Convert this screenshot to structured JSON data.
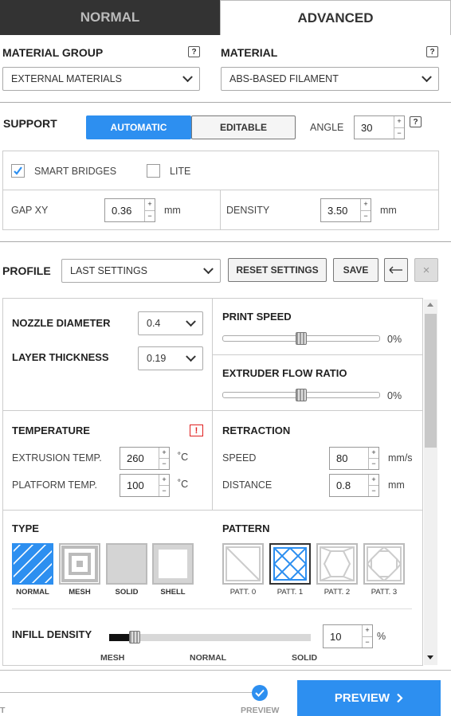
{
  "tabs": {
    "normal": "NORMAL",
    "advanced": "ADVANCED"
  },
  "material": {
    "group_label": "MATERIAL GROUP",
    "group_value": "EXTERNAL MATERIALS",
    "material_label": "MATERIAL",
    "material_value": "ABS-BASED FILAMENT",
    "help": "?"
  },
  "support": {
    "label": "SUPPORT",
    "automatic": "AUTOMATIC",
    "editable": "EDITABLE",
    "angle_label": "ANGLE",
    "angle_value": "30",
    "smart_bridges": "SMART BRIDGES",
    "lite": "LITE",
    "gap_label": "GAP XY",
    "gap_value": "0.36",
    "gap_unit": "mm",
    "density_label": "DENSITY",
    "density_value": "3.50",
    "density_unit": "mm"
  },
  "profile": {
    "label": "PROFILE",
    "value": "LAST SETTINGS",
    "reset": "RESET SETTINGS",
    "save": "SAVE",
    "close": "×"
  },
  "settings": {
    "nozzle_label": "NOZZLE DIAMETER",
    "nozzle_value": "0.4",
    "layer_label": "LAYER THICKNESS",
    "layer_value": "0.19",
    "print_speed_label": "PRINT SPEED",
    "print_speed_value": "0%",
    "flow_label": "EXTRUDER FLOW RATIO",
    "flow_value": "0%",
    "temperature_label": "TEMPERATURE",
    "warning": "!",
    "extrusion_label": "EXTRUSION TEMP.",
    "extrusion_value": "260",
    "extrusion_unit": "˚C",
    "platform_label": "PLATFORM TEMP.",
    "platform_value": "100",
    "platform_unit": "˚C",
    "retraction_label": "RETRACTION",
    "speed_label": "SPEED",
    "speed_value": "80",
    "speed_unit": "mm/s",
    "distance_label": "DISTANCE",
    "distance_value": "0.8",
    "distance_unit": "mm",
    "type_label": "TYPE",
    "types": [
      "NORMAL",
      "MESH",
      "SOLID",
      "SHELL"
    ],
    "pattern_label": "PATTERN",
    "patterns": [
      "PATT. 0",
      "PATT. 1",
      "PATT. 2",
      "PATT. 3"
    ],
    "infill_label": "INFILL DENSITY",
    "infill_value": "10",
    "infill_unit": "%",
    "infill_marks": [
      "MESH",
      "NORMAL",
      "SOLID"
    ]
  },
  "footer": {
    "step_left": "T",
    "step_preview": "PREVIEW",
    "preview_button": "PREVIEW"
  },
  "colors": {
    "accent": "#2d8ff0",
    "tab_dark": "#333333",
    "warning": "#e02020"
  }
}
